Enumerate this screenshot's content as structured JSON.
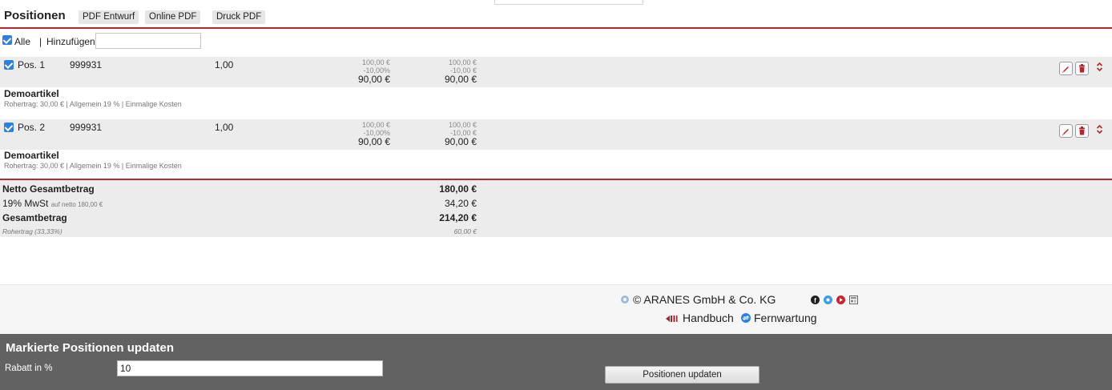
{
  "header": {
    "title": "Positionen",
    "buttons": [
      "PDF Entwurf",
      "Online PDF",
      "Druck PDF"
    ]
  },
  "add_row": {
    "all_label": "Alle",
    "separator": "|",
    "add_label": "Hinzufügen",
    "add_value": ""
  },
  "positions": [
    {
      "label": "Pos. 1",
      "article_no": "999931",
      "quantity": "1,00",
      "price_gross": "100,00 €",
      "discount_pct": "-10,00%",
      "price_net": "90,00 €",
      "total_gross": "100,00 €",
      "total_discount": "-10,00 €",
      "total_net": "90,00 €",
      "name": "Demoartikel",
      "details": "Rohertrag: 30,00 € | Allgemein 19 % | Einmalige Kosten"
    },
    {
      "label": "Pos. 2",
      "article_no": "999931",
      "quantity": "1,00",
      "price_gross": "100,00 €",
      "discount_pct": "-10,00%",
      "price_net": "90,00 €",
      "total_gross": "100,00 €",
      "total_discount": "-10,00 €",
      "total_net": "90,00 €",
      "name": "Demoartikel",
      "details": "Rohertrag: 30,00 € | Allgemein 19 % | Einmalige Kosten"
    }
  ],
  "totals": {
    "netto_label": "Netto Gesamtbetrag",
    "netto_value": "180,00 €",
    "mwst_label": "19% MwSt",
    "mwst_sub": "auf netto 180,00 €",
    "mwst_value": "34,20 €",
    "gesamt_label": "Gesamtbetrag",
    "gesamt_value": "214,20 €",
    "rohertrag_label": "Rohertrag (33,33%)",
    "rohertrag_value": "60,00 €"
  },
  "footer": {
    "copyright": "© ARANES GmbH & Co. KG",
    "handbook": "Handbuch",
    "remote": "Fernwartung"
  },
  "bulk_update": {
    "title": "Markierte Positionen updaten",
    "discount_label": "Rabatt in %",
    "discount_value": "10",
    "button": "Positionen updaten"
  },
  "colors": {
    "accent_red": "#b3272d",
    "row_gray": "#ececec",
    "checkbox_blue": "#2f7fe0",
    "panel_dark": "#626262"
  }
}
